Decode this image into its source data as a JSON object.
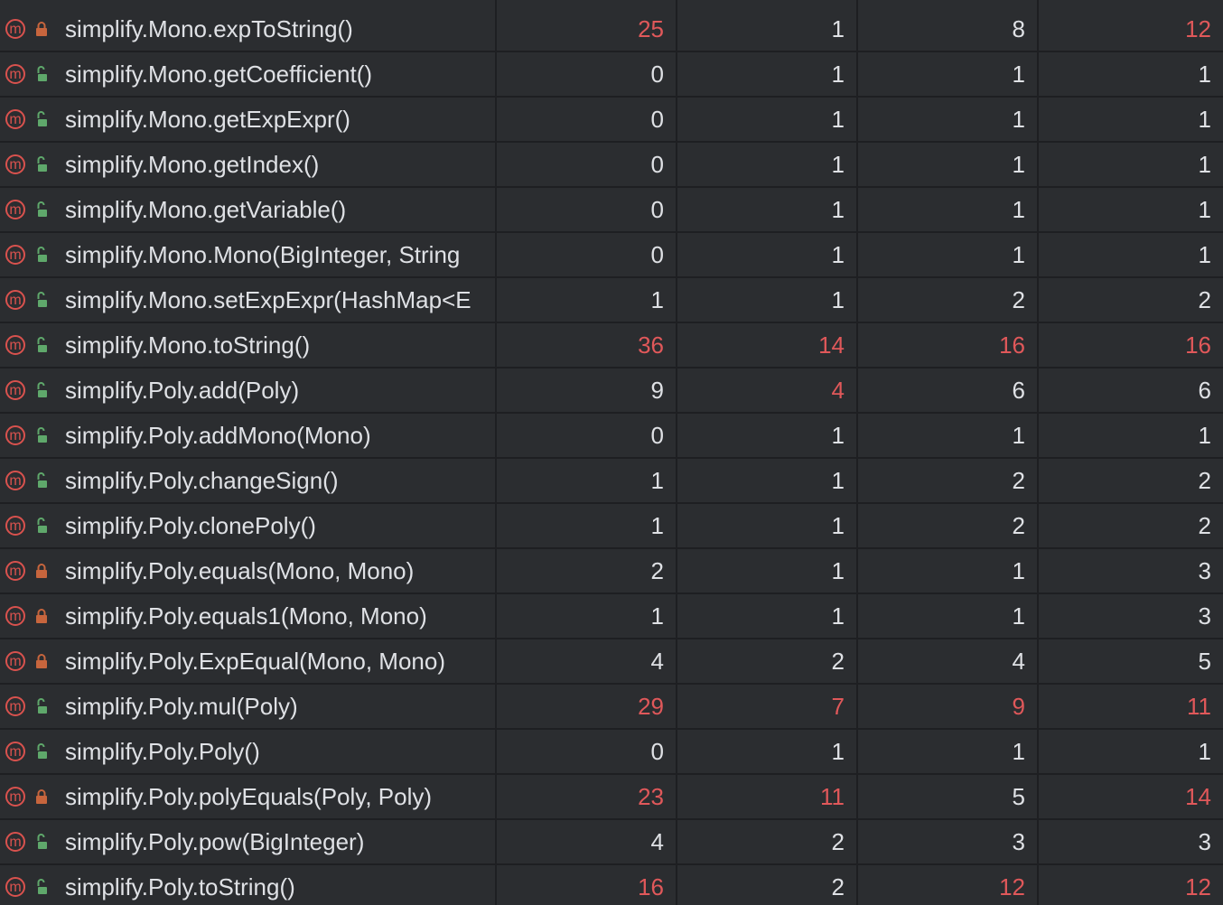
{
  "rows": [
    {
      "name": "simplify.Mono.expToString()",
      "access": "private",
      "v": [
        "25",
        "1",
        "8",
        "12"
      ],
      "hot": [
        true,
        false,
        false,
        true
      ]
    },
    {
      "name": "simplify.Mono.getCoefficient()",
      "access": "public",
      "v": [
        "0",
        "1",
        "1",
        "1"
      ],
      "hot": [
        false,
        false,
        false,
        false
      ]
    },
    {
      "name": "simplify.Mono.getExpExpr()",
      "access": "public",
      "v": [
        "0",
        "1",
        "1",
        "1"
      ],
      "hot": [
        false,
        false,
        false,
        false
      ]
    },
    {
      "name": "simplify.Mono.getIndex()",
      "access": "public",
      "v": [
        "0",
        "1",
        "1",
        "1"
      ],
      "hot": [
        false,
        false,
        false,
        false
      ]
    },
    {
      "name": "simplify.Mono.getVariable()",
      "access": "public",
      "v": [
        "0",
        "1",
        "1",
        "1"
      ],
      "hot": [
        false,
        false,
        false,
        false
      ]
    },
    {
      "name": "simplify.Mono.Mono(BigInteger, String",
      "access": "public",
      "v": [
        "0",
        "1",
        "1",
        "1"
      ],
      "hot": [
        false,
        false,
        false,
        false
      ]
    },
    {
      "name": "simplify.Mono.setExpExpr(HashMap<E",
      "access": "public",
      "v": [
        "1",
        "1",
        "2",
        "2"
      ],
      "hot": [
        false,
        false,
        false,
        false
      ]
    },
    {
      "name": "simplify.Mono.toString()",
      "access": "public",
      "v": [
        "36",
        "14",
        "16",
        "16"
      ],
      "hot": [
        true,
        true,
        true,
        true
      ]
    },
    {
      "name": "simplify.Poly.add(Poly)",
      "access": "public",
      "v": [
        "9",
        "4",
        "6",
        "6"
      ],
      "hot": [
        false,
        true,
        false,
        false
      ]
    },
    {
      "name": "simplify.Poly.addMono(Mono)",
      "access": "public",
      "v": [
        "0",
        "1",
        "1",
        "1"
      ],
      "hot": [
        false,
        false,
        false,
        false
      ]
    },
    {
      "name": "simplify.Poly.changeSign()",
      "access": "public",
      "v": [
        "1",
        "1",
        "2",
        "2"
      ],
      "hot": [
        false,
        false,
        false,
        false
      ]
    },
    {
      "name": "simplify.Poly.clonePoly()",
      "access": "public",
      "v": [
        "1",
        "1",
        "2",
        "2"
      ],
      "hot": [
        false,
        false,
        false,
        false
      ]
    },
    {
      "name": "simplify.Poly.equals(Mono, Mono)",
      "access": "private",
      "v": [
        "2",
        "1",
        "1",
        "3"
      ],
      "hot": [
        false,
        false,
        false,
        false
      ]
    },
    {
      "name": "simplify.Poly.equals1(Mono, Mono)",
      "access": "private",
      "v": [
        "1",
        "1",
        "1",
        "3"
      ],
      "hot": [
        false,
        false,
        false,
        false
      ]
    },
    {
      "name": "simplify.Poly.ExpEqual(Mono, Mono)",
      "access": "private",
      "v": [
        "4",
        "2",
        "4",
        "5"
      ],
      "hot": [
        false,
        false,
        false,
        false
      ]
    },
    {
      "name": "simplify.Poly.mul(Poly)",
      "access": "public",
      "v": [
        "29",
        "7",
        "9",
        "11"
      ],
      "hot": [
        true,
        true,
        true,
        true
      ]
    },
    {
      "name": "simplify.Poly.Poly()",
      "access": "public",
      "v": [
        "0",
        "1",
        "1",
        "1"
      ],
      "hot": [
        false,
        false,
        false,
        false
      ]
    },
    {
      "name": "simplify.Poly.polyEquals(Poly, Poly)",
      "access": "private",
      "v": [
        "23",
        "11",
        "5",
        "14"
      ],
      "hot": [
        true,
        true,
        false,
        true
      ]
    },
    {
      "name": "simplify.Poly.pow(BigInteger)",
      "access": "public",
      "v": [
        "4",
        "2",
        "3",
        "3"
      ],
      "hot": [
        false,
        false,
        false,
        false
      ]
    },
    {
      "name": "simplify.Poly.toString()",
      "access": "public",
      "v": [
        "16",
        "2",
        "12",
        "12"
      ],
      "hot": [
        true,
        false,
        true,
        true
      ]
    }
  ],
  "icons": {
    "method_glyph": "m",
    "method_color": "#d9524e",
    "private_lock_color": "#c7653d",
    "public_lock_color": "#5fa86b"
  },
  "colors": {
    "background": "#2b2d30",
    "grid": "#1e1f22",
    "text": "#dfe1e5",
    "hot_value": "#e0585a"
  }
}
